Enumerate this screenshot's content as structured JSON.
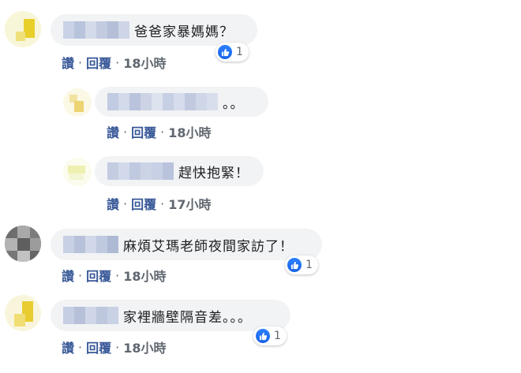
{
  "actions": {
    "like": "讚",
    "reply": "回覆",
    "separator": "·"
  },
  "comments": [
    {
      "text": "爸爸家暴媽媽？",
      "time": "18小時",
      "reactions": "1"
    },
    {
      "text": "。。",
      "time": "18小時"
    },
    {
      "text": "趕快抱緊！",
      "time": "17小時"
    },
    {
      "text": "麻煩艾瑪老師夜間家訪了！",
      "time": "18小時",
      "reactions": "1"
    },
    {
      "text": "家裡牆壁隔音差。。。",
      "time": "18小時",
      "reactions": "1"
    }
  ],
  "colors": {
    "link": "#385898",
    "bubble": "#f2f3f5",
    "like_blue": "#1877f2"
  },
  "icons": {
    "reaction": "thumbs-up-icon",
    "avatar": "pixelated-avatar"
  }
}
